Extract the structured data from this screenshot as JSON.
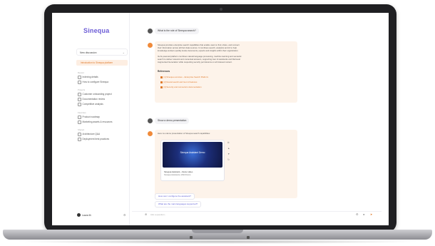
{
  "app": {
    "logo": "Sinequa"
  },
  "sidebar": {
    "new_button": "New discussion",
    "active_item": "Introduction to Sinequa platform",
    "sections": [
      {
        "title": "Recent",
        "items": [
          "Indexing details",
          "How to configure Sinequa"
        ]
      },
      {
        "title": "Projects",
        "items": [
          "Customer onboarding project",
          "Documentation review",
          "Competitive analysis"
        ]
      },
      {
        "title": "Favorites",
        "items": [
          "Product roadmap",
          "Marketing assets & resources"
        ]
      },
      {
        "title": "Shared",
        "items": [
          "Architecture Q&A",
          "Deployment best practices"
        ]
      }
    ],
    "user": "Laura M."
  },
  "chat": {
    "q1": "What is the role of Sinequa search?",
    "a1_lines": [
      "Sinequa provides enterprise search capabilities that enable users to find, share, and connect",
      "their information across all their data sources. It combines search, analytics and AI to help",
      "knowledge workers quickly locate documents, experts and insights within their organization.",
      "",
      "Its AI-powered platform combines natural language processing, machine learning and semantic",
      "search to deliver relevant and contextual answers, supporting Gen AI assistants and Retrieval",
      "Augmented Generation while respecting security permissions on all indexed content."
    ],
    "refs_title": "References",
    "refs": [
      "[1] Sinequa overview – Enterprise Search Platform",
      "[2] Neural search and Gen AI features",
      "[3] Security and connectors documentation"
    ],
    "q2": "Show a demo presentation",
    "a2_intro": "Here is a demo presentation of Sinequa search capabilities:",
    "video_title": "Sinequa Assistant Demo",
    "video_caption": "Sinequa Assistant – Demo video",
    "video_sub": "Sinequa Assistants | 2024 Demo",
    "suggestions": [
      "How can I configure the assistant?",
      "What are the main languages supported?"
    ],
    "composer_placeholder": "Ask a question..."
  },
  "colors": {
    "accent": "#e07a2b",
    "brand": "#6b5bd6",
    "answer_bg": "#fdf3ea"
  }
}
